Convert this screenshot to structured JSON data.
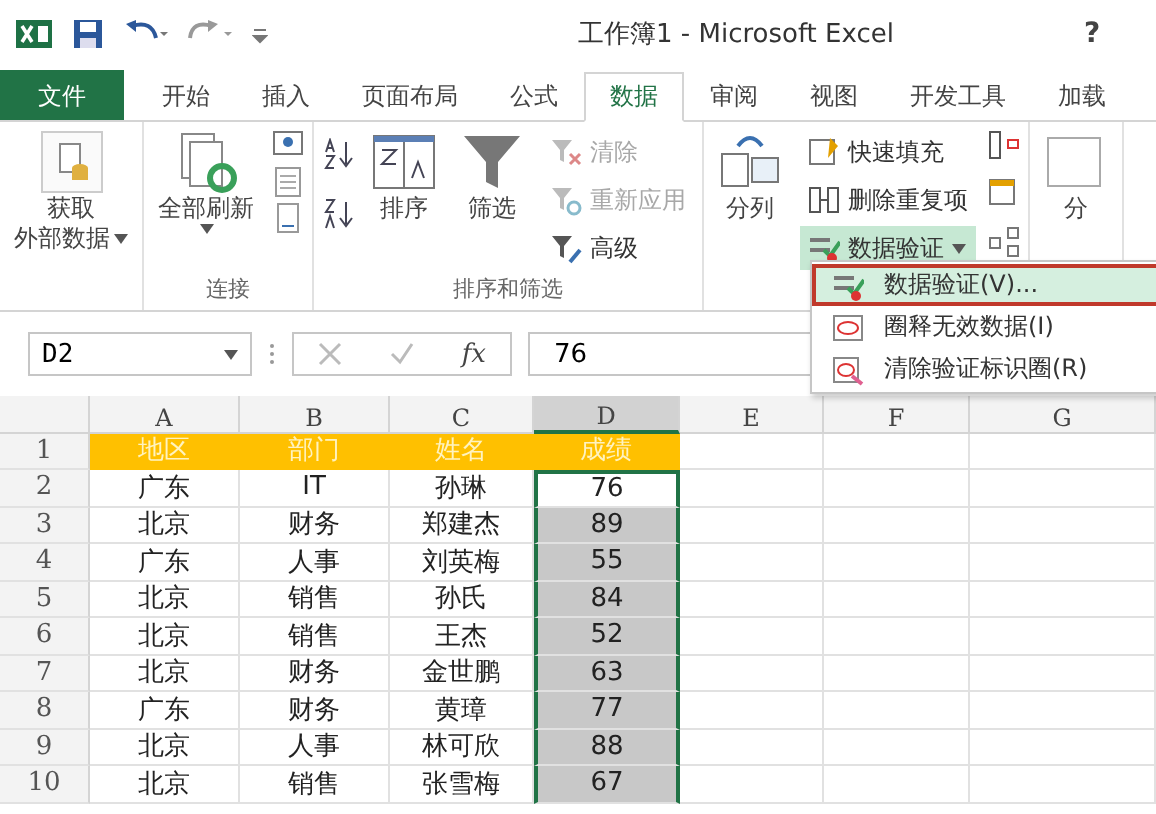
{
  "title_bar": {
    "title": "工作簿1 - Microsoft Excel",
    "help": "?"
  },
  "tabs": [
    {
      "label": "文件",
      "kind": "file",
      "selected": false
    },
    {
      "label": "开始",
      "kind": "tab",
      "selected": false
    },
    {
      "label": "插入",
      "kind": "tab",
      "selected": false
    },
    {
      "label": "页面布局",
      "kind": "tab",
      "selected": false
    },
    {
      "label": "公式",
      "kind": "tab",
      "selected": false
    },
    {
      "label": "数据",
      "kind": "tab",
      "selected": true
    },
    {
      "label": "审阅",
      "kind": "tab",
      "selected": false
    },
    {
      "label": "视图",
      "kind": "tab",
      "selected": false
    },
    {
      "label": "开发工具",
      "kind": "tab",
      "selected": false
    },
    {
      "label": "加载",
      "kind": "tab",
      "selected": false
    }
  ],
  "ribbon": {
    "groups": [
      {
        "columns": [
          {
            "kind": "large",
            "lines": [
              "获取",
              "外部数据"
            ],
            "dropdown": true
          }
        ]
      },
      {
        "label": "连接",
        "columns": [
          {
            "kind": "large",
            "lines": [
              "全部刷新"
            ],
            "dropdown": true
          },
          {
            "kind": "icon-stack"
          }
        ]
      },
      {
        "label": "排序和筛选",
        "columns": [
          {
            "kind": "sort-stack"
          },
          {
            "kind": "large",
            "lines": [
              "排序"
            ],
            "dropdown": false
          },
          {
            "kind": "large",
            "lines": [
              "筛选"
            ],
            "dropdown": false
          },
          {
            "kind": "stack",
            "items": [
              {
                "label": "清除",
                "disabled": true,
                "pressed": false,
                "dropdown": false
              },
              {
                "label": "重新应用",
                "disabled": true,
                "pressed": false,
                "dropdown": false
              },
              {
                "label": "高级",
                "disabled": false,
                "pressed": false,
                "dropdown": false
              }
            ]
          }
        ]
      },
      {
        "columns": [
          {
            "kind": "large",
            "lines": [
              "分列"
            ],
            "dropdown": false
          },
          {
            "kind": "stack",
            "items": [
              {
                "label": "快速填充",
                "disabled": false,
                "pressed": false,
                "dropdown": false
              },
              {
                "label": "删除重复项",
                "disabled": false,
                "pressed": false,
                "dropdown": false
              },
              {
                "label": "数据验证",
                "disabled": false,
                "pressed": true,
                "dropdown": true
              }
            ]
          },
          {
            "kind": "icon-stack"
          }
        ]
      },
      {
        "columns": [
          {
            "kind": "large",
            "lines": [
              "分"
            ],
            "dropdown": false
          }
        ]
      }
    ]
  },
  "menu": {
    "items": [
      {
        "label": "数据验证(V)...",
        "selected": true
      },
      {
        "label": "圈释无效数据(I)",
        "selected": false
      },
      {
        "label": "清除验证标识圈(R)",
        "selected": false
      }
    ]
  },
  "formula_bar": {
    "name_box": "D2",
    "function_label": "fx",
    "value": "76"
  },
  "sheet": {
    "columns": [
      {
        "label": "A",
        "selected": false
      },
      {
        "label": "B",
        "selected": false
      },
      {
        "label": "C",
        "selected": false
      },
      {
        "label": "D",
        "selected": true
      },
      {
        "label": "E",
        "selected": false
      },
      {
        "label": "F",
        "selected": false
      },
      {
        "label": "G",
        "selected": false
      }
    ],
    "rows": [
      {
        "number": "1",
        "kind": "header",
        "cells": [
          {
            "text": "地区",
            "selected": false,
            "active": false
          },
          {
            "text": "部门",
            "selected": false,
            "active": false
          },
          {
            "text": "姓名",
            "selected": false,
            "active": false
          },
          {
            "text": "成绩",
            "selected": false,
            "active": false
          }
        ]
      },
      {
        "number": "2",
        "kind": "data",
        "cells": [
          {
            "text": "广东",
            "selected": false,
            "active": false
          },
          {
            "text": "IT",
            "selected": false,
            "active": false
          },
          {
            "text": "孙琳",
            "selected": false,
            "active": false
          },
          {
            "text": "76",
            "selected": true,
            "active": true
          }
        ]
      },
      {
        "number": "3",
        "kind": "data",
        "cells": [
          {
            "text": "北京",
            "selected": false,
            "active": false
          },
          {
            "text": "财务",
            "selected": false,
            "active": false
          },
          {
            "text": "郑建杰",
            "selected": false,
            "active": false
          },
          {
            "text": "89",
            "selected": true,
            "active": false
          }
        ]
      },
      {
        "number": "4",
        "kind": "data",
        "cells": [
          {
            "text": "广东",
            "selected": false,
            "active": false
          },
          {
            "text": "人事",
            "selected": false,
            "active": false
          },
          {
            "text": "刘英梅",
            "selected": false,
            "active": false
          },
          {
            "text": "55",
            "selected": true,
            "active": false
          }
        ]
      },
      {
        "number": "5",
        "kind": "data",
        "cells": [
          {
            "text": "北京",
            "selected": false,
            "active": false
          },
          {
            "text": "销售",
            "selected": false,
            "active": false
          },
          {
            "text": "孙氏",
            "selected": false,
            "active": false
          },
          {
            "text": "84",
            "selected": true,
            "active": false
          }
        ]
      },
      {
        "number": "6",
        "kind": "data",
        "cells": [
          {
            "text": "北京",
            "selected": false,
            "active": false
          },
          {
            "text": "销售",
            "selected": false,
            "active": false
          },
          {
            "text": "王杰",
            "selected": false,
            "active": false
          },
          {
            "text": "52",
            "selected": true,
            "active": false
          }
        ]
      },
      {
        "number": "7",
        "kind": "data",
        "cells": [
          {
            "text": "北京",
            "selected": false,
            "active": false
          },
          {
            "text": "财务",
            "selected": false,
            "active": false
          },
          {
            "text": "金世鹏",
            "selected": false,
            "active": false
          },
          {
            "text": "63",
            "selected": true,
            "active": false
          }
        ]
      },
      {
        "number": "8",
        "kind": "data",
        "cells": [
          {
            "text": "广东",
            "selected": false,
            "active": false
          },
          {
            "text": "财务",
            "selected": false,
            "active": false
          },
          {
            "text": "黄璋",
            "selected": false,
            "active": false
          },
          {
            "text": "77",
            "selected": true,
            "active": false
          }
        ]
      },
      {
        "number": "9",
        "kind": "data",
        "cells": [
          {
            "text": "北京",
            "selected": false,
            "active": false
          },
          {
            "text": "人事",
            "selected": false,
            "active": false
          },
          {
            "text": "林可欣",
            "selected": false,
            "active": false
          },
          {
            "text": "88",
            "selected": true,
            "active": false
          }
        ]
      },
      {
        "number": "10",
        "kind": "data",
        "cells": [
          {
            "text": "北京",
            "selected": false,
            "active": false
          },
          {
            "text": "销售",
            "selected": false,
            "active": false
          },
          {
            "text": "张雪梅",
            "selected": false,
            "active": false
          },
          {
            "text": "67",
            "selected": true,
            "active": false
          }
        ]
      }
    ]
  }
}
